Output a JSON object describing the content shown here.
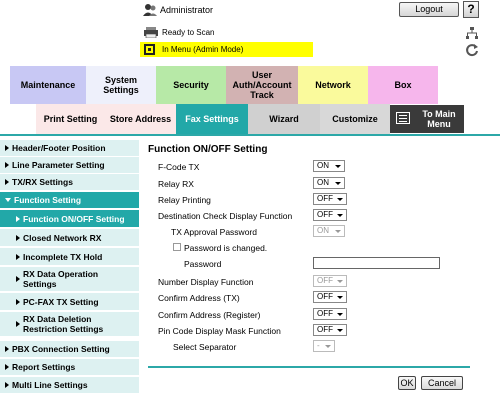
{
  "header": {
    "user_label": "Administrator",
    "logout_label": "Logout",
    "help_label": "?",
    "status_ready": "Ready to Scan",
    "status_mode": "In Menu (Admin Mode)"
  },
  "nav": {
    "tabs": [
      {
        "label": "Maintenance"
      },
      {
        "label": "System Settings"
      },
      {
        "label": "Security"
      },
      {
        "label": "User Auth/Account Track"
      },
      {
        "label": "Network"
      },
      {
        "label": "Box"
      }
    ],
    "sub_tabs": [
      {
        "label": "Print Setting"
      },
      {
        "label": "Store Address"
      },
      {
        "label": "Fax Settings",
        "active": true
      },
      {
        "label": "Wizard"
      },
      {
        "label": "Customize"
      }
    ],
    "to_main_menu": "To Main Menu"
  },
  "sidebar": {
    "items": [
      {
        "label": "Header/Footer Position"
      },
      {
        "label": "Line Parameter Setting"
      },
      {
        "label": "TX/RX Settings"
      },
      {
        "label": "Function Setting",
        "expanded": true
      },
      {
        "label": "Function ON/OFF Setting",
        "active": true
      },
      {
        "label": "Closed Network RX"
      },
      {
        "label": "Incomplete TX Hold"
      },
      {
        "label": "RX Data Operation Settings"
      },
      {
        "label": "PC-FAX TX Setting"
      },
      {
        "label": "RX Data Deletion Restriction Settings"
      },
      {
        "label": "PBX Connection Setting"
      },
      {
        "label": "Report Settings"
      },
      {
        "label": "Multi Line Settings"
      }
    ]
  },
  "form": {
    "title": "Function ON/OFF Setting",
    "rows": [
      {
        "label": "F-Code TX",
        "value": "ON"
      },
      {
        "label": "Relay RX",
        "value": "ON"
      },
      {
        "label": "Relay Printing",
        "value": "OFF"
      },
      {
        "label": "Destination Check Display Function",
        "value": "OFF"
      },
      {
        "label": "TX Approval Password",
        "value": "ON"
      },
      {
        "label": "Password is changed.",
        "value": ""
      },
      {
        "label": "Password",
        "value": ""
      },
      {
        "label": "Number Display Function",
        "value": "OFF"
      },
      {
        "label": "Confirm Address (TX)",
        "value": "OFF"
      },
      {
        "label": "Confirm Address (Register)",
        "value": "OFF"
      },
      {
        "label": "Pin Code Display Mask Function",
        "value": "OFF"
      },
      {
        "label": "Select Separator",
        "value": "-"
      }
    ],
    "ok_label": "OK",
    "cancel_label": "Cancel"
  }
}
